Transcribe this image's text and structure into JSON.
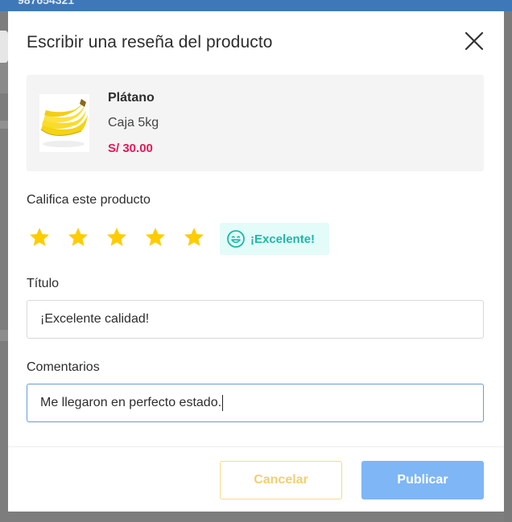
{
  "background": {
    "phone_text": "987654321"
  },
  "modal": {
    "title": "Escribir una reseña del producto",
    "close_icon": "close-icon"
  },
  "product": {
    "name": "Plátano",
    "variant": "Caja 5kg",
    "price": "S/ 30.00",
    "image_icon": "banana-image"
  },
  "rating": {
    "label": "Califica este producto",
    "value": 5,
    "max": 5,
    "badge_text": "¡Excelente!",
    "badge_icon": "happy-face-icon",
    "star_color": "#ffcc00",
    "badge_color": "#1fb7aa"
  },
  "title_field": {
    "label": "Título",
    "value": "¡Excelente calidad!"
  },
  "comments_field": {
    "label": "Comentarios",
    "value": "Me llegaron en perfecto estado."
  },
  "actions": {
    "cancel_label": "Cancelar",
    "publish_label": "Publicar"
  },
  "colors": {
    "price": "#e0195a",
    "publish_button": "#7fb6f5",
    "cancel_text": "#f3cf6e"
  }
}
